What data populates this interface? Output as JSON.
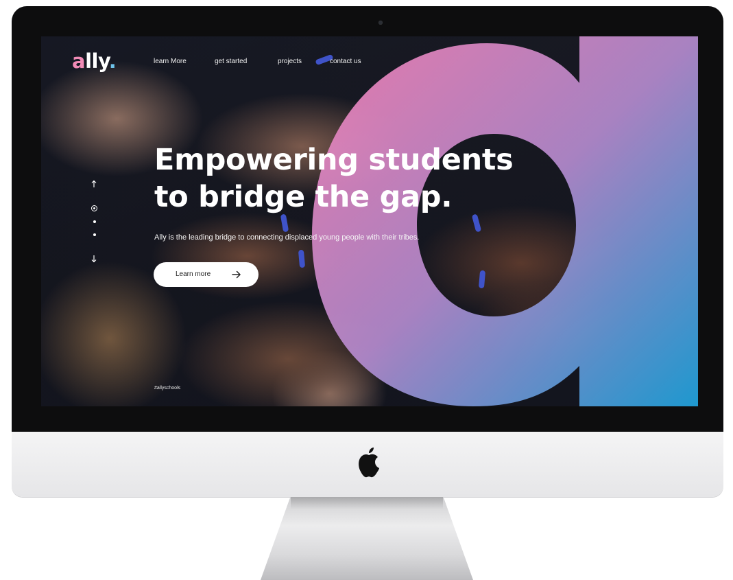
{
  "brand": {
    "logo_a": "a",
    "logo_rest": "lly",
    "logo_dot": "."
  },
  "nav": {
    "items": [
      "learn More",
      "get started",
      "projects",
      "contact us"
    ]
  },
  "hero": {
    "title_line1": "Empowering students",
    "title_line2": "to bridge the gap.",
    "subtitle": "Ally is the leading bridge to connecting displaced young people with their tribes.",
    "cta_label": "Learn more",
    "cta_icon": "arrow-right-icon"
  },
  "side_nav": {
    "up_icon": "arrow-up-icon",
    "down_icon": "arrow-down-icon",
    "slide_count": 3,
    "active_slide": 1
  },
  "footer": {
    "hashtag": "#allyschools"
  },
  "colors": {
    "brand_pink": "#f27fb3",
    "brand_purple": "#a98fd6",
    "brand_blue": "#1f9fd8",
    "cta_background": "#ffffff"
  }
}
